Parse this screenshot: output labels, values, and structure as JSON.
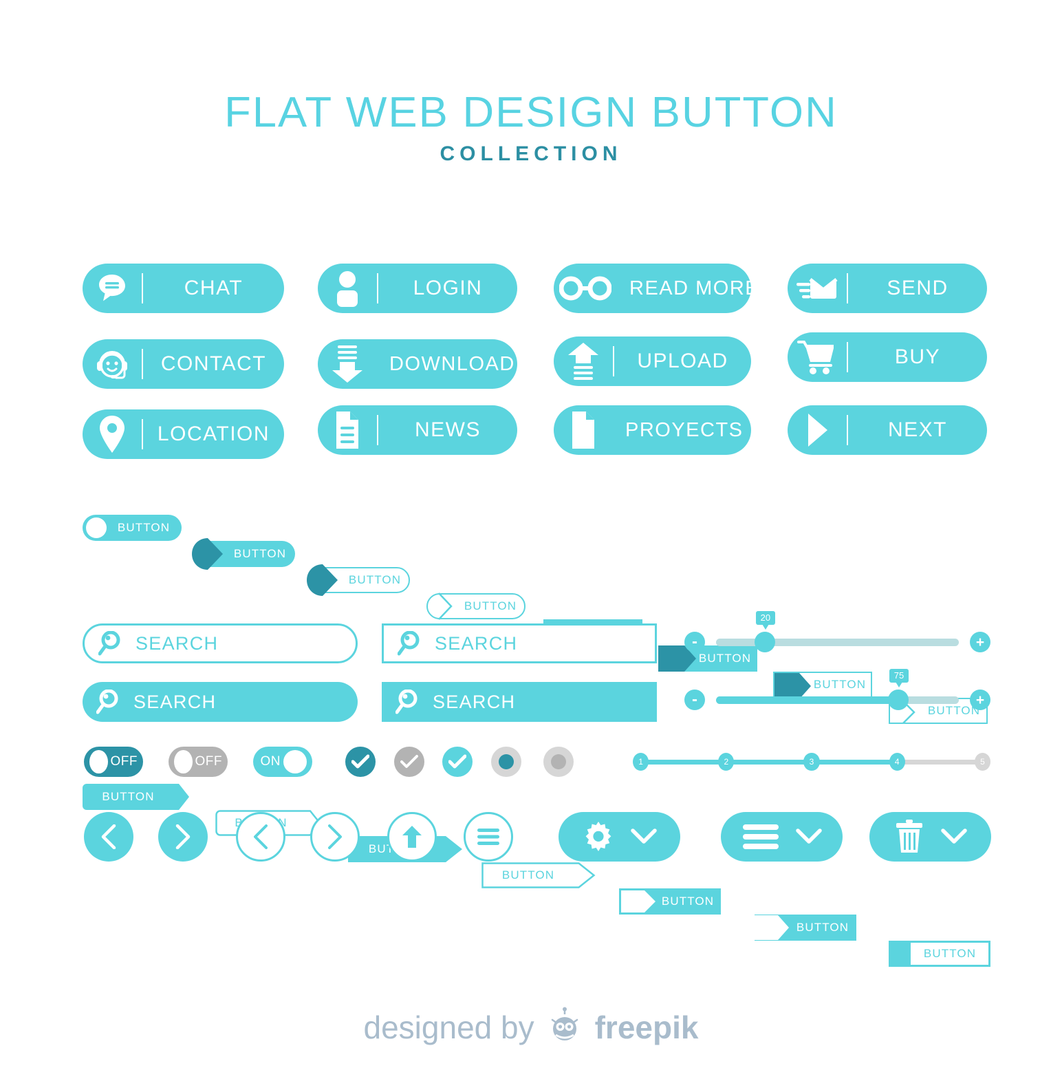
{
  "title": {
    "main": "FLAT WEB DESIGN BUTTON",
    "sub": "COLLECTION"
  },
  "colors": {
    "cyan": "#5BD4DE",
    "teal_dark": "#2C93A6",
    "gray": "#B3B3B3",
    "gray_light": "#D6D6D6",
    "track_gray": "#B9DDE0",
    "footer_gray": "#A9BCCC",
    "title_main": "#58D3E2",
    "title_sub": "#2C8FA3"
  },
  "icon_buttons": [
    {
      "label": "CHAT",
      "icon": "chat-bubble-icon"
    },
    {
      "label": "LOGIN",
      "icon": "user-icon"
    },
    {
      "label": "READ MORE",
      "icon": "glasses-icon"
    },
    {
      "label": "SEND",
      "icon": "envelope-send-icon"
    },
    {
      "label": "CONTACT",
      "icon": "headset-support-icon"
    },
    {
      "label": "DOWNLOAD",
      "icon": "download-arrow-icon"
    },
    {
      "label": "UPLOAD",
      "icon": "upload-arrow-icon"
    },
    {
      "label": "BUY",
      "icon": "shopping-cart-icon"
    },
    {
      "label": "LOCATION",
      "icon": "map-pin-icon"
    },
    {
      "label": "NEWS",
      "icon": "document-lines-icon"
    },
    {
      "label": "PROYECTS",
      "icon": "file-page-icon"
    },
    {
      "label": "NEXT",
      "icon": "play-triangle-icon"
    }
  ],
  "button_variants_row1": [
    {
      "label": "BUTTON",
      "style": "pill-solid-circle"
    },
    {
      "label": "BUTTON",
      "style": "pill-solid-dark-chevron"
    },
    {
      "label": "BUTTON",
      "style": "pill-outline-dark-chevron"
    },
    {
      "label": "BUTTON",
      "style": "pill-outline-chevron"
    },
    {
      "label": "BUTTON",
      "style": "rect-solid"
    },
    {
      "label": "BUTTON",
      "style": "rect-solid-dark-chevron"
    },
    {
      "label": "BUTTON",
      "style": "rect-outline-dark-chevron"
    },
    {
      "label": "BUTTON",
      "style": "rect-outline-chevron"
    }
  ],
  "button_variants_row2": [
    {
      "label": "BUTTON",
      "style": "tag-solid-rounded"
    },
    {
      "label": "BUTTON",
      "style": "tag-outline-rounded"
    },
    {
      "label": "BUTTON",
      "style": "arrow-solid"
    },
    {
      "label": "BUTTON",
      "style": "arrow-outline"
    },
    {
      "label": "BUTTON",
      "style": "ribbon-solid-notch"
    },
    {
      "label": "BUTTON",
      "style": "ribbon-outline-notch"
    },
    {
      "label": "BUTTON",
      "style": "split-block"
    }
  ],
  "search_fields": [
    {
      "text": "SEARCH",
      "style": "outline-rounded",
      "icon": "magnifier-icon"
    },
    {
      "text": "SEARCH",
      "style": "outline-square",
      "icon": "magnifier-icon"
    },
    {
      "text": "SEARCH",
      "style": "solid-rounded",
      "icon": "magnifier-icon"
    },
    {
      "text": "SEARCH",
      "style": "solid-square",
      "icon": "magnifier-icon"
    }
  ],
  "sliders": [
    {
      "value": "20",
      "percent": 20,
      "minus": "-",
      "plus": "+",
      "filled": false
    },
    {
      "value": "75",
      "percent": 75,
      "minus": "-",
      "plus": "+",
      "filled": true
    }
  ],
  "toggles": [
    {
      "label": "OFF",
      "state": "off",
      "color": "teal_dark"
    },
    {
      "label": "OFF",
      "state": "off",
      "color": "gray"
    },
    {
      "label": "ON",
      "state": "on",
      "color": "cyan"
    }
  ],
  "checks": [
    {
      "icon": "check-icon",
      "color": "teal_dark"
    },
    {
      "icon": "check-icon",
      "color": "gray"
    },
    {
      "icon": "check-icon",
      "color": "cyan"
    }
  ],
  "radios": [
    {
      "icon": "radio-icon",
      "color": "teal_dark",
      "selected": true
    },
    {
      "icon": "radio-icon",
      "color": "gray",
      "selected": true
    }
  ],
  "steps": {
    "items": [
      "1",
      "2",
      "3",
      "4",
      "5"
    ],
    "active_count": 4
  },
  "round_buttons": [
    {
      "icon": "chevron-left-icon",
      "style": "solid"
    },
    {
      "icon": "chevron-right-icon",
      "style": "solid"
    },
    {
      "icon": "chevron-left-icon",
      "style": "outline"
    },
    {
      "icon": "chevron-right-icon",
      "style": "outline"
    },
    {
      "icon": "arrow-up-icon",
      "style": "outline"
    },
    {
      "icon": "hamburger-icon",
      "style": "outline"
    }
  ],
  "dropdown_buttons": [
    {
      "icon": "gear-icon",
      "chevron": "chevron-down-icon"
    },
    {
      "icon": "hamburger-icon",
      "chevron": "chevron-down-icon"
    },
    {
      "icon": "trash-icon",
      "chevron": "chevron-down-icon"
    }
  ],
  "footer": {
    "designed_by": "designed by",
    "brand": "freepik",
    "logo": "freepik-robot-icon"
  }
}
